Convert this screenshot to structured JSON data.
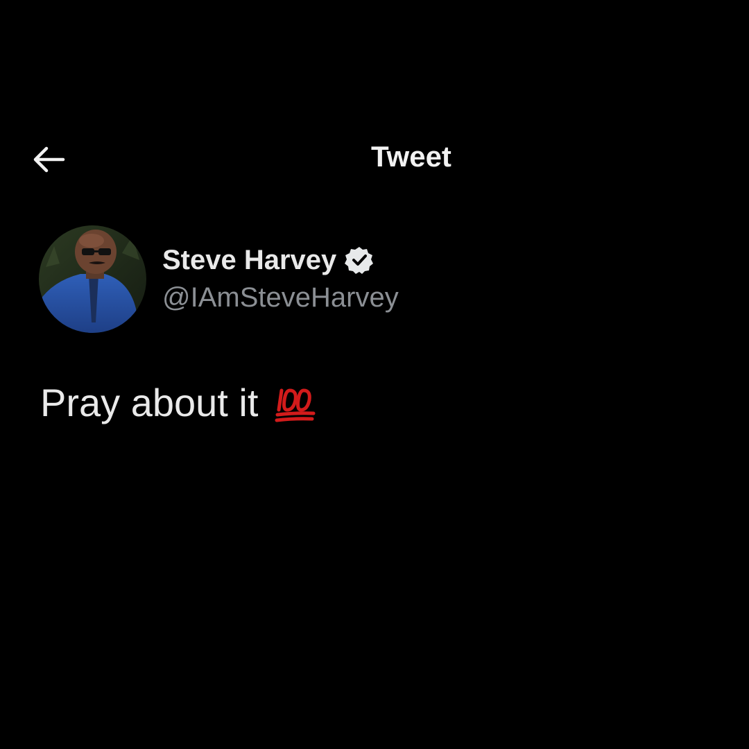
{
  "header": {
    "title": "Tweet",
    "back_icon": "arrow-left-icon"
  },
  "author": {
    "display_name": "Steve Harvey",
    "handle": "@IAmSteveHarvey",
    "verified_icon": "verified-badge-icon"
  },
  "tweet": {
    "text": "Pray about it",
    "emoji": "hundred-points-icon"
  },
  "colors": {
    "background": "#000000",
    "primary_text": "#e7e9ea",
    "secondary_text": "#8b8f94",
    "emoji_red": "#d21b1b"
  }
}
